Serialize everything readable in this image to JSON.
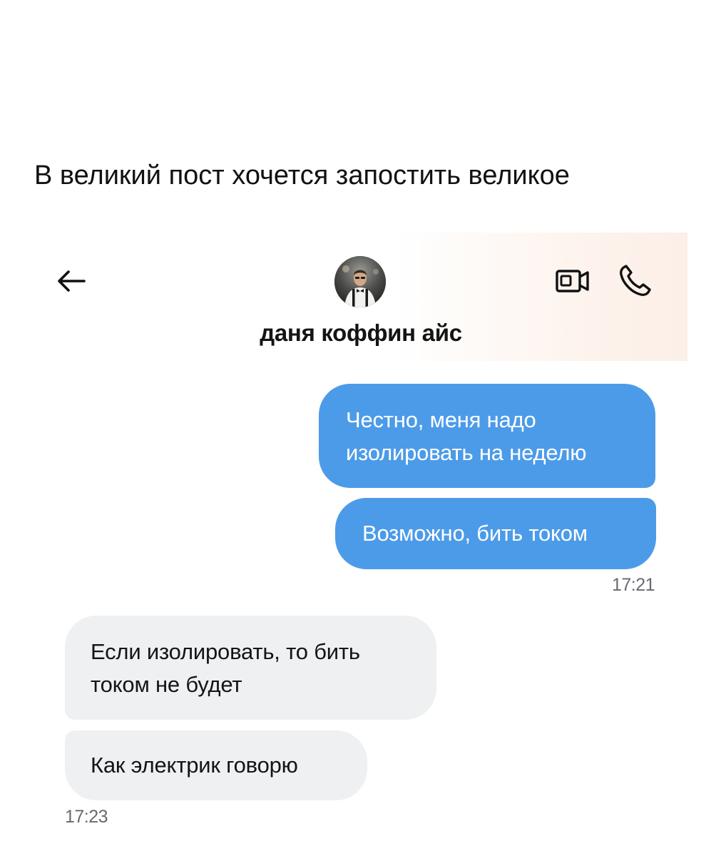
{
  "post": {
    "text": "В великий пост хочется запостить великое"
  },
  "chat": {
    "contact_name": "даня коффин айс",
    "icons": {
      "back": "arrow-left-icon",
      "video": "video-camera-icon",
      "call": "phone-icon"
    },
    "colors": {
      "outgoing_bubble": "#4c9be8",
      "incoming_bubble": "#eef0f2"
    },
    "messages": [
      {
        "direction": "outgoing",
        "text": "Честно, меня надо изолировать на неделю"
      },
      {
        "direction": "outgoing",
        "text": "Возможно, бить током"
      },
      {
        "direction": "incoming",
        "text": "Если изолировать, то бить током не будет"
      },
      {
        "direction": "incoming",
        "text": "Как электрик говорю"
      }
    ],
    "timestamps": {
      "outgoing": "17:21",
      "incoming": "17:23"
    }
  }
}
